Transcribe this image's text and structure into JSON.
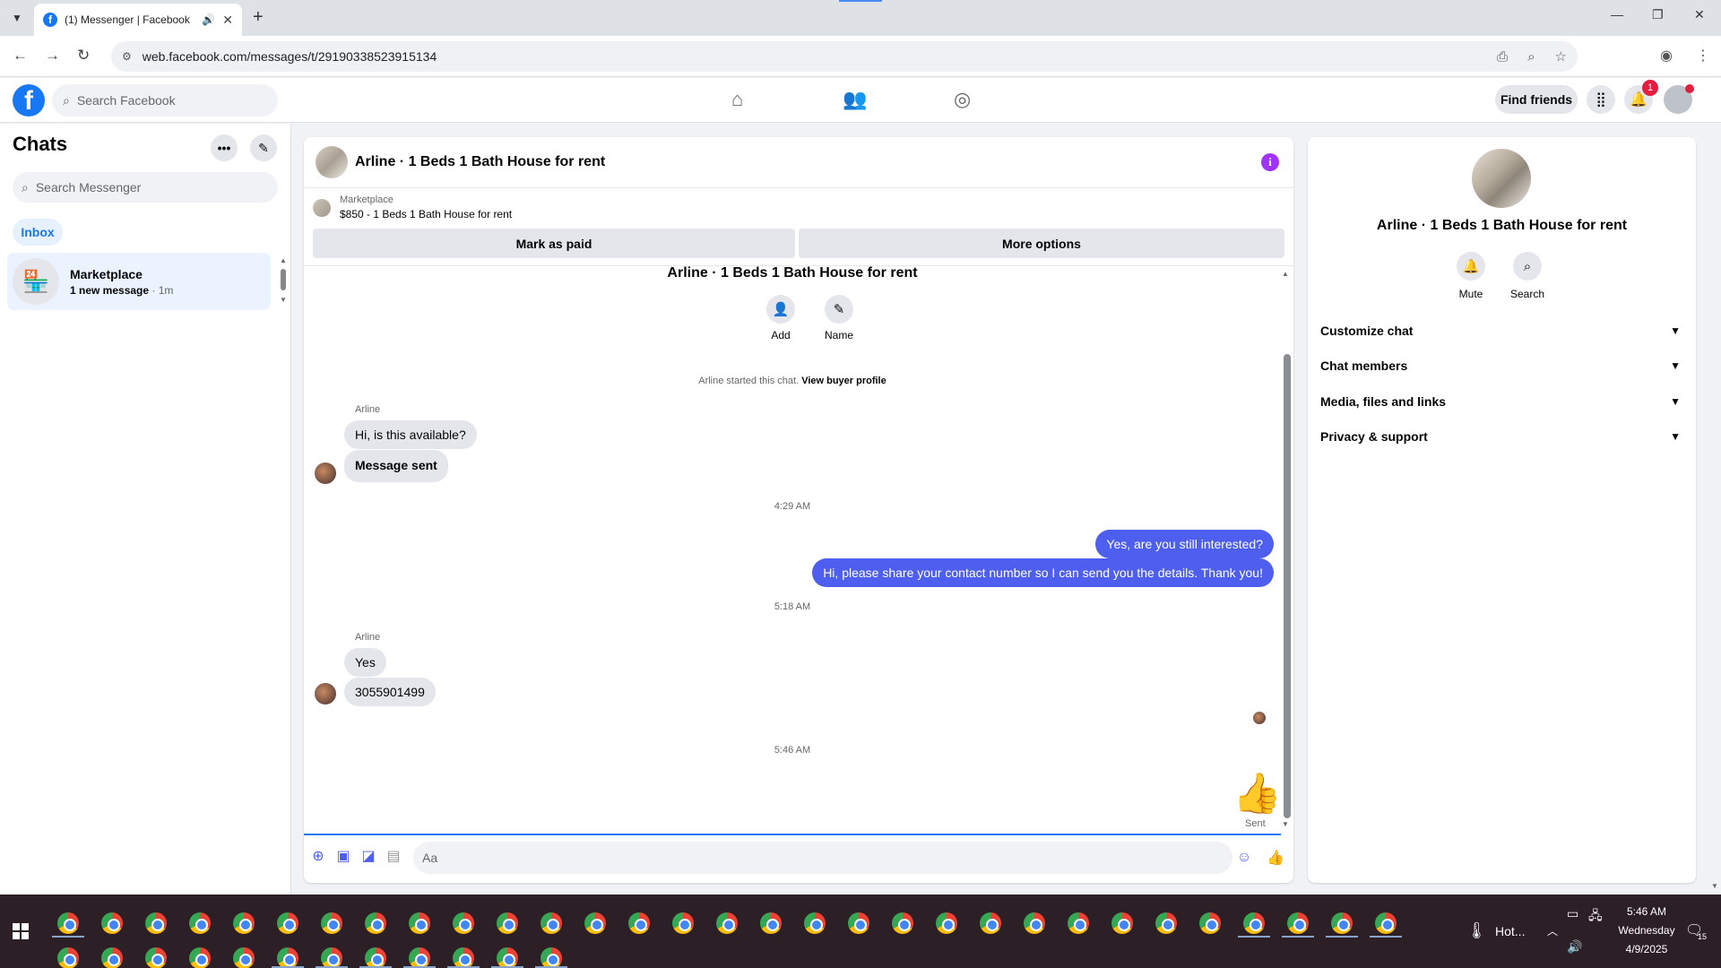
{
  "browser": {
    "tab_title": "(1) Messenger | Facebook",
    "url": "web.facebook.com/messages/t/29190338523915134",
    "favicon": "f"
  },
  "fb": {
    "search_placeholder": "Search Facebook",
    "find_friends": "Find friends",
    "notification_count": "1",
    "logo": "f"
  },
  "chats": {
    "title": "Chats",
    "search_placeholder": "Search Messenger",
    "inbox_label": "Inbox",
    "items": [
      {
        "name": "Marketplace",
        "preview": "1 new message",
        "time": " · 1m"
      }
    ]
  },
  "conversation": {
    "title": "Arline · 1 Beds 1 Bath House for rent",
    "marketplace_label": "Marketplace",
    "listing": "$850 - 1 Beds 1 Bath House for rent",
    "mark_paid": "Mark as paid",
    "more_options": "More options",
    "chat_title": "Arline · 1 Beds 1 Bath House for rent",
    "add_label": "Add",
    "name_label": "Name",
    "started_text": "Arline started this chat. ",
    "view_buyer": "View buyer profile",
    "sender1": "Arline",
    "msg1": "Hi, is this available?",
    "msg2": "Message sent",
    "time1": "4:29 AM",
    "out1": "Yes, are you still interested?",
    "out2": "Hi, please share your contact number so I can send you the details. Thank you!",
    "time2": "5:18 AM",
    "sender2": "Arline",
    "msg3": "Yes",
    "msg4": "3055901499",
    "time3": "5:46 AM",
    "sent_label": "Sent",
    "input_placeholder": "Aa"
  },
  "info_panel": {
    "name": "Arline · 1 Beds 1 Bath House for rent",
    "mute": "Mute",
    "search": "Search",
    "sections": [
      "Customize chat",
      "Chat members",
      "Media, files and links",
      "Privacy & support"
    ]
  },
  "taskbar": {
    "weather": "Hot...",
    "time": "5:46 AM",
    "day": "Wednesday",
    "date": "4/9/2025",
    "notif_count": "15"
  },
  "colors": {
    "accent": "#1877f2",
    "bubble_out": "#4e5ff0",
    "info_icon": "#a033ff"
  }
}
